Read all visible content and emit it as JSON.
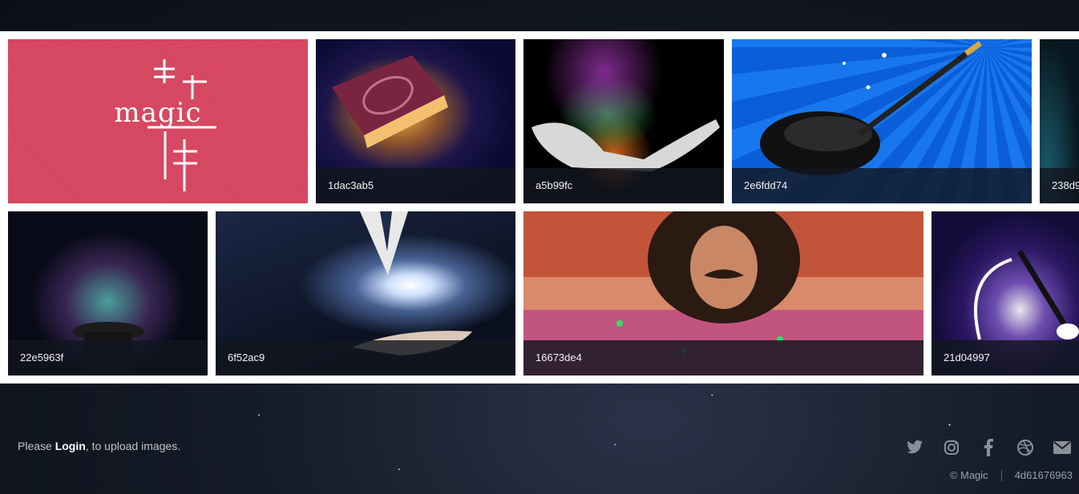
{
  "gallery": {
    "row1": [
      {
        "name": "logo-tile",
        "logo_text": "magic"
      },
      {
        "name": "book",
        "caption": "1dac3ab5"
      },
      {
        "name": "smoke-hand",
        "caption": "a5b99fc"
      },
      {
        "name": "hat-wand",
        "caption": "2e6fdd74"
      },
      {
        "name": "partial",
        "caption": "238d9"
      }
    ],
    "row2": [
      {
        "name": "tophat",
        "caption": "22e5963f"
      },
      {
        "name": "galaxy",
        "caption": "6f52ac9"
      },
      {
        "name": "man",
        "caption": "16673de4"
      },
      {
        "name": "wand-swirl",
        "caption": "21d04997"
      }
    ]
  },
  "footer": {
    "prompt_before": "Please ",
    "login_label": "Login",
    "prompt_after": ", to upload images.",
    "social_icons": [
      "twitter-icon",
      "instagram-icon",
      "facebook-icon",
      "dribbble-icon",
      "mail-icon"
    ],
    "copyright": "© Magic",
    "build_id": "4d61676963"
  },
  "colors": {
    "logo_tile_bg": "#d6455f",
    "caption_bg": "#12161f",
    "footer_text": "#bfc4cc",
    "icon_color": "#8a9099"
  }
}
